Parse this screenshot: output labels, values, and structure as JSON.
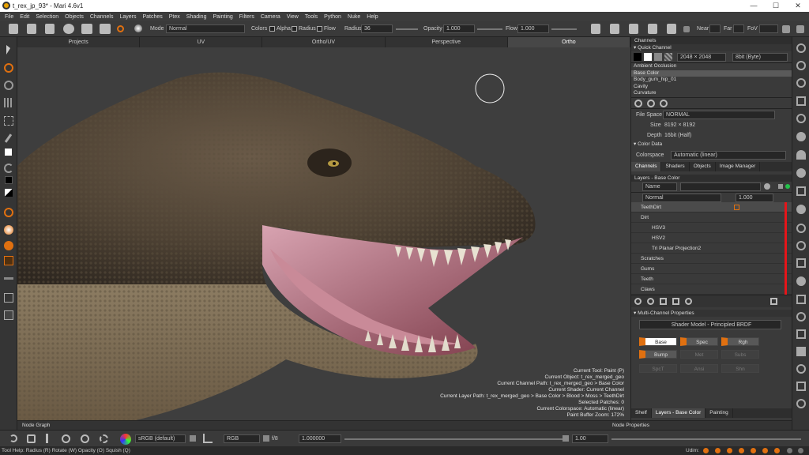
{
  "window": {
    "title": "t_rex_jp_93* - Mari 4.6v1",
    "minimize": "—",
    "maximize": "☐",
    "close": "✕"
  },
  "menu": [
    "File",
    "Edit",
    "Selection",
    "Objects",
    "Channels",
    "Layers",
    "Patches",
    "Ptex",
    "Shading",
    "Painting",
    "Filters",
    "Camera",
    "View",
    "Tools",
    "Python",
    "Nuke",
    "Help"
  ],
  "toolbar": {
    "mode_label": "Mode",
    "mode_value": "Normal",
    "colors_label": "Colors",
    "alpha_label": "Alpha",
    "radius_chk_label": "Radius",
    "flow_chk_label": "Flow",
    "radius_label": "Radius",
    "radius_value": "36",
    "opacity_label": "Opacity",
    "opacity_value": "1.000",
    "flow_label": "Flow",
    "flow_value": "1.000",
    "near_label": "Near",
    "far_label": "Far",
    "fov_label": "FoV"
  },
  "view_tabs": [
    "Projects",
    "UV",
    "Ortho/UV",
    "Perspective",
    "Ortho"
  ],
  "viewport_info": [
    "Current Tool: Paint (P)",
    "Current Object: t_rex_merged_geo",
    "Current Channel Path: t_rex_merged_geo > Base Color",
    "Current Shader: Current Channel",
    "Current Layer Path: t_rex_merged_geo > Base Color > Blood > Moss > TeethDirt",
    "Selected Patches: 0",
    "Current Colorspace: Automatic (linear)",
    "Paint Buffer Zoom: 172%"
  ],
  "node_graph_label": "Node Graph",
  "channels_panel": {
    "title": "Channels",
    "quick_channel": "Quick Channel",
    "resolution": "2048 × 2048",
    "depth_sel": "8bit (Byte)",
    "channels": [
      "Ambient Occlusion",
      "Base Color",
      "Body_gum_hip_01",
      "Cavity",
      "Curvature"
    ],
    "selected_channel": "Base Color",
    "file_space_label": "File Space",
    "file_space_value": "NORMAL",
    "size_label": "Size",
    "size_value": "8192 × 8192",
    "depth_label": "Depth",
    "depth_value": "16bit (Half)",
    "color_data": "Color Data",
    "colorspace_label": "Colorspace",
    "colorspace_value": "Automatic (linear)",
    "tabs": [
      "Channels",
      "Shaders",
      "Objects",
      "Image Manager"
    ]
  },
  "layers_panel": {
    "title": "Layers - Base Color",
    "filter_label": "Name",
    "blend_mode": "Normal",
    "opacity_value": "1.000",
    "layers": [
      {
        "name": "TeethDirt",
        "level": 0,
        "expanded": false,
        "selected": true
      },
      {
        "name": "Dirt",
        "level": 0,
        "expanded": true,
        "selected": false
      },
      {
        "name": "HSV3",
        "level": 1,
        "expanded": false,
        "selected": false
      },
      {
        "name": "HSV2",
        "level": 1,
        "expanded": false,
        "selected": false
      },
      {
        "name": "Tri Planar Projection2",
        "level": 1,
        "expanded": false,
        "selected": false
      },
      {
        "name": "Scratches",
        "level": 0,
        "expanded": false,
        "selected": false
      },
      {
        "name": "Gums",
        "level": 0,
        "expanded": false,
        "selected": false
      },
      {
        "name": "Teeth",
        "level": 0,
        "expanded": false,
        "selected": false
      },
      {
        "name": "Claws",
        "level": 0,
        "expanded": false,
        "selected": false
      }
    ]
  },
  "mcp_panel": {
    "title": "Multi-Channel Properties",
    "shader_model": "Shader Model - Principled BRDF",
    "buttons": [
      {
        "label": "Base",
        "state": "on"
      },
      {
        "label": "Spec",
        "state": "orange"
      },
      {
        "label": "Rgh",
        "state": "orange"
      },
      {
        "label": "Bump",
        "state": "on"
      },
      {
        "label": "Met",
        "state": "off"
      },
      {
        "label": "Subs",
        "state": "off"
      },
      {
        "label": "SpcT",
        "state": "off"
      },
      {
        "label": "Ansi",
        "state": "off"
      },
      {
        "label": "Shn",
        "state": "off"
      }
    ]
  },
  "bottom_tabs": [
    "Shelf",
    "Layers - Base Color",
    "Painting"
  ],
  "node_properties_label": "Node Properties",
  "bottom_toolbar": {
    "colorspace": "sRGB (default)",
    "channel_mode": "RGB",
    "fstop_label": "f/8",
    "exposure_value": "1.000000",
    "gamma_value": "1.00"
  },
  "statusbar": {
    "text": "Tool Help:  Radius (R)   Rotate (W)   Opacity (O)   Squish (Q)",
    "udim_label": "Udim:"
  },
  "colors": {
    "accent": "#e07010",
    "selection": "#5a5a5a",
    "indicator_red": "#e6151a"
  }
}
